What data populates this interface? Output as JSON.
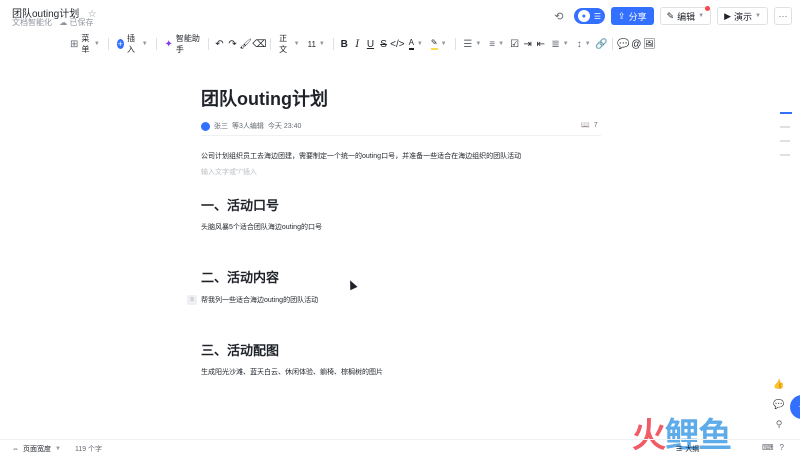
{
  "header": {
    "title": "团队outing计划",
    "subtitle": "文档智能化",
    "save_status": "已保存",
    "collaborators": [
      "张三"
    ],
    "share_label": "分享",
    "edit_label": "编辑",
    "present_label": "演示"
  },
  "toolbar": {
    "menu_label": "菜单",
    "insert_label": "插入",
    "assistant_label": "智能助手",
    "style_label": "正文",
    "font_size": "11"
  },
  "document": {
    "title": "团队outing计划",
    "meta": {
      "author": "张三",
      "editors": "等3人编辑",
      "time": "今天 23:40",
      "comments_count": "7"
    },
    "intro": "公司计划组织员工去海边团建，需要制定一个统一的outing口号，并准备一些适合在海边组织的团队活动",
    "placeholder": "输入文字或\"/\"插入",
    "sections": [
      {
        "heading": "一、活动口号",
        "body": "头脑风暴5个适合团队海边outing的口号"
      },
      {
        "heading": "二、活动内容",
        "body": "帮我列一些适合海边outing的团队活动"
      },
      {
        "heading": "三、活动配图",
        "body": "生成阳光沙滩、蓝天白云、休闲体验、躺椅、棕榈树的图片"
      }
    ]
  },
  "statusbar": {
    "page_width_label": "页面宽度",
    "word_count": "119 个字",
    "outline_label": "大纲"
  },
  "watermark": {
    "text_red": "火",
    "text_blue": "鲤鱼"
  },
  "colors": {
    "accent": "#3370ff",
    "text": "#1f2329",
    "muted": "#8f959e"
  }
}
